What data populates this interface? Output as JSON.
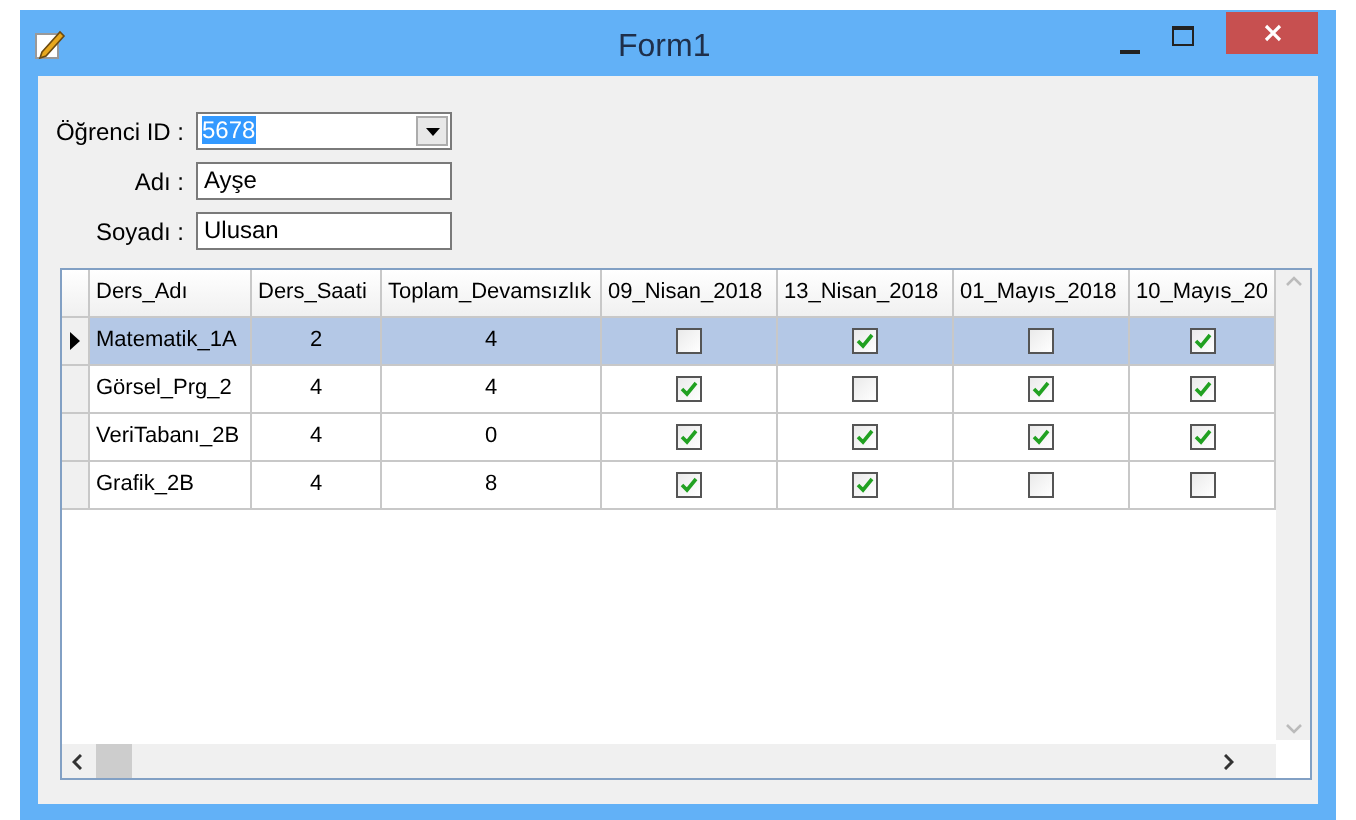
{
  "window": {
    "title": "Form1"
  },
  "form": {
    "student_id": {
      "label": "Öğrenci ID :",
      "value": "5678"
    },
    "first_name": {
      "label": "Adı :",
      "value": "Ayşe"
    },
    "last_name": {
      "label": "Soyadı :",
      "value": "Ulusan"
    }
  },
  "table": {
    "columns": [
      "Ders_Adı",
      "Ders_Saati",
      "Toplam_Devamsızlık",
      "09_Nisan_2018",
      "13_Nisan_2018",
      "01_Mayıs_2018",
      "10_Mayıs_20"
    ],
    "rows": [
      {
        "selected": true,
        "current": true,
        "name": "Matematik_1A",
        "hours": "2",
        "absence": "4",
        "checks": [
          false,
          true,
          false,
          true
        ]
      },
      {
        "selected": false,
        "current": false,
        "name": "Görsel_Prg_2",
        "hours": "4",
        "absence": "4",
        "checks": [
          true,
          false,
          true,
          true
        ]
      },
      {
        "selected": false,
        "current": false,
        "name": "VeriTabanı_2B",
        "hours": "4",
        "absence": "0",
        "checks": [
          true,
          true,
          true,
          true
        ]
      },
      {
        "selected": false,
        "current": false,
        "name": "Grafik_2B",
        "hours": "4",
        "absence": "8",
        "checks": [
          true,
          true,
          false,
          false
        ]
      }
    ]
  }
}
